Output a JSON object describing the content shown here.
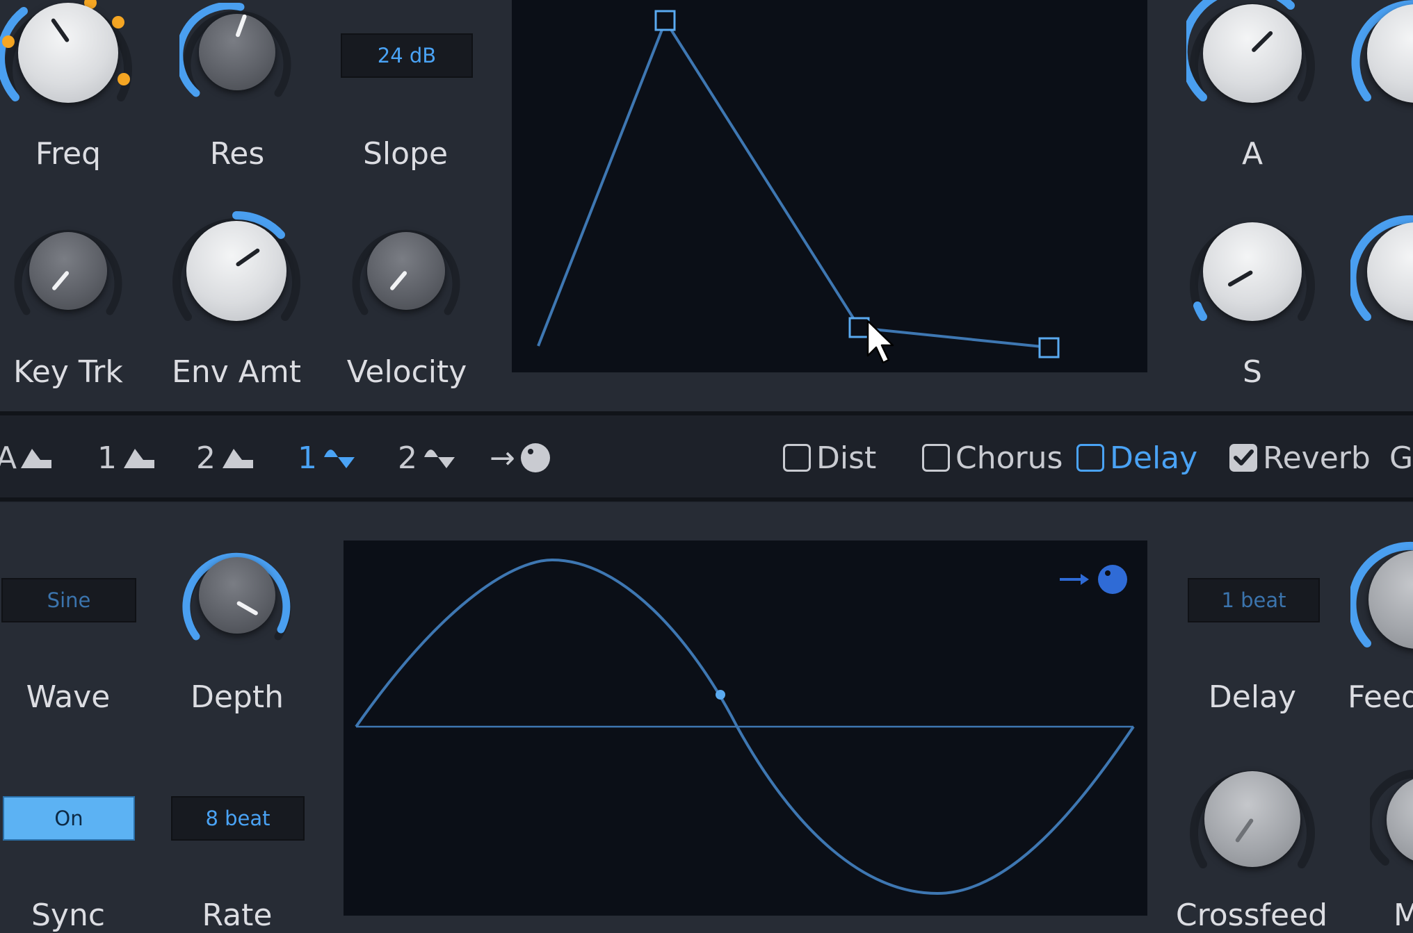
{
  "filter": {
    "freq_label": "Freq",
    "res_label": "Res",
    "slope_label": "Slope",
    "slope_value": "24 dB",
    "keytrk_label": "Key Trk",
    "envamt_label": "Env Amt",
    "velocity_label": "Velocity"
  },
  "envelope": {
    "a_label": "A",
    "s_label": "S"
  },
  "tabs": [
    {
      "label": "A",
      "icon": "envelope-shape-icon"
    },
    {
      "label": "1",
      "icon": "envelope-shape-icon"
    },
    {
      "label": "2",
      "icon": "envelope-shape-icon"
    },
    {
      "label": "1",
      "icon": "lfo-shape-icon",
      "active": true
    },
    {
      "label": "2",
      "icon": "lfo-shape-icon"
    },
    {
      "label": "→",
      "icon": "knob-target-icon"
    }
  ],
  "effects": [
    {
      "label": "Dist",
      "checked": false
    },
    {
      "label": "Chorus",
      "checked": false
    },
    {
      "label": "Delay",
      "checked": false,
      "active": true
    },
    {
      "label": "Reverb",
      "checked": true
    },
    {
      "label": "G"
    }
  ],
  "lfo": {
    "wave_label": "Wave",
    "wave_value": "Sine",
    "depth_label": "Depth",
    "sync_label": "Sync",
    "sync_value": "On",
    "rate_label": "Rate",
    "rate_value": "8 beat"
  },
  "delay": {
    "delay_label": "Delay",
    "delay_value": "1 beat",
    "feed_label": "Feed",
    "crossfeed_label": "Crossfeed",
    "m_label": "M"
  },
  "colors": {
    "accent": "#4aa3f5",
    "orange": "#f5a623",
    "panel": "#262b34",
    "display": "#0b0f17",
    "curve": "#3e77b2"
  }
}
